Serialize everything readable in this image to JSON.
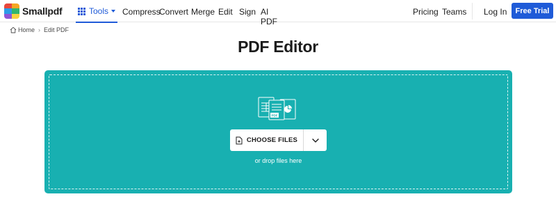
{
  "brand": {
    "name": "Smallpdf",
    "logo_colors": [
      "#e8473c",
      "#f5a623",
      "#2c9be8",
      "#8f55d6",
      "#32b56e",
      "#f7d23f"
    ]
  },
  "nav": {
    "tools_label": "Tools",
    "items": [
      "Compress",
      "Convert",
      "Merge",
      "Edit",
      "Sign",
      "AI PDF"
    ],
    "accent_color": "#1f5bd8"
  },
  "right_nav": {
    "pricing": "Pricing",
    "teams": "Teams",
    "login": "Log In",
    "trial": "Free Trial"
  },
  "breadcrumb": {
    "home": "Home",
    "current": "Edit PDF",
    "separator": "›"
  },
  "page": {
    "title": "PDF Editor"
  },
  "dropzone": {
    "choose_label": "CHOOSE FILES",
    "hint": "or drop files here",
    "background_color": "#18b0b1",
    "icon": "files-stack-icon",
    "menu_icon": "chevron-down-icon"
  }
}
